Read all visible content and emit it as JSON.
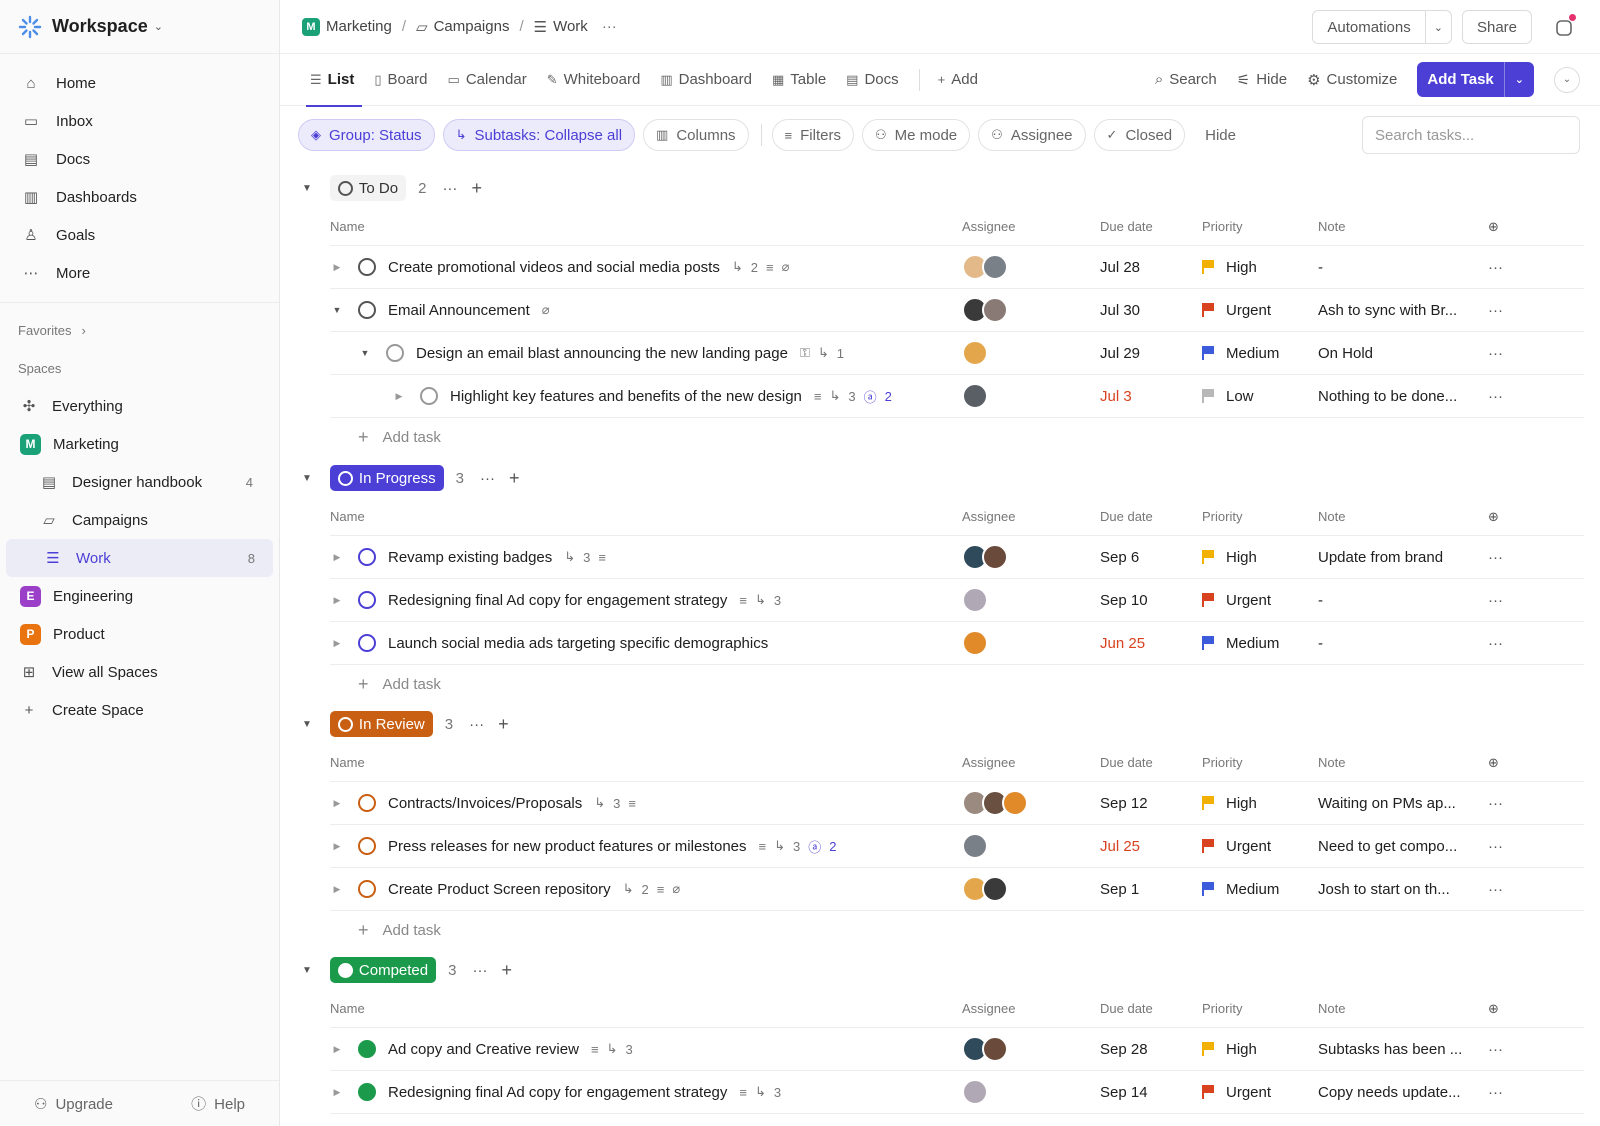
{
  "workspace": {
    "title": "Workspace"
  },
  "nav": {
    "home": "Home",
    "inbox": "Inbox",
    "docs": "Docs",
    "dashboards": "Dashboards",
    "goals": "Goals",
    "more": "More"
  },
  "favorites": {
    "label": "Favorites"
  },
  "spaces": {
    "label": "Spaces",
    "everything": "Everything",
    "marketing": {
      "letter": "M",
      "label": "Marketing",
      "color": "#1aa177"
    },
    "designer_handbook": {
      "label": "Designer handbook",
      "count": "4"
    },
    "campaigns": "Campaigns",
    "work": {
      "label": "Work",
      "count": "8"
    },
    "engineering": {
      "letter": "E",
      "label": "Engineering",
      "color": "#9b3fc9"
    },
    "product": {
      "letter": "P",
      "label": "Product",
      "color": "#e8730f"
    },
    "view_all": "View all Spaces",
    "create": "Create Space"
  },
  "footer": {
    "upgrade": "Upgrade",
    "help": "Help"
  },
  "breadcrumb": {
    "space_letter": "M",
    "space": "Marketing",
    "folder": "Campaigns",
    "list": "Work"
  },
  "top_actions": {
    "automations": "Automations",
    "share": "Share"
  },
  "tabs": {
    "list": "List",
    "board": "Board",
    "calendar": "Calendar",
    "whiteboard": "Whiteboard",
    "dashboard": "Dashboard",
    "table": "Table",
    "docs": "Docs",
    "add": "Add"
  },
  "tab_actions": {
    "search": "Search",
    "hide": "Hide",
    "customize": "Customize",
    "add_task": "Add Task"
  },
  "filters": {
    "group": "Group: Status",
    "subtasks": "Subtasks: Collapse all",
    "columns": "Columns",
    "filters": "Filters",
    "me_mode": "Me mode",
    "assignee": "Assignee",
    "closed": "Closed",
    "hide": "Hide",
    "search_placeholder": "Search tasks..."
  },
  "columns": {
    "name": "Name",
    "assignee": "Assignee",
    "due": "Due date",
    "priority": "Priority",
    "note": "Note"
  },
  "add_task": "Add task",
  "colors": {
    "accent": "#4b3fd6",
    "urgent": "#d8421f",
    "high": "#f2b000",
    "medium": "#3b5bdb",
    "low": "#b8b8b8"
  },
  "groups": [
    {
      "label": "To Do",
      "count": "2",
      "color": "#555555",
      "tasks": [
        {
          "name": "Create promotional videos and social media posts",
          "meta": "2",
          "due": "Jul 28",
          "priority": "High",
          "note": "-"
        },
        {
          "name": "Email Announcement",
          "meta": "",
          "due": "Jul 30",
          "priority": "Urgent",
          "note": "Ash to sync with Br..."
        },
        {
          "name": "Design an email blast announcing the new landing page",
          "meta": "1",
          "due": "Jul 29",
          "priority": "Medium",
          "note": "On Hold"
        },
        {
          "name": "Highlight key features and benefits of the new design",
          "meta": "3",
          "meta2": "2",
          "due": "Jul 3",
          "priority": "Low",
          "note": "Nothing to be done..."
        }
      ]
    },
    {
      "label": "In Progress",
      "count": "3",
      "color": "#4b3fd6",
      "tasks": [
        {
          "name": "Revamp existing badges",
          "meta": "3",
          "due": "Sep 6",
          "priority": "High",
          "note": "Update from brand"
        },
        {
          "name": "Redesigning final Ad copy for engagement strategy",
          "meta": "3",
          "due": "Sep 10",
          "priority": "Urgent",
          "note": "-"
        },
        {
          "name": "Launch social media ads targeting specific demographics",
          "meta": "",
          "due": "Jun 25",
          "priority": "Medium",
          "note": "-"
        }
      ]
    },
    {
      "label": "In Review",
      "count": "3",
      "color": "#c95f12",
      "tasks": [
        {
          "name": "Contracts/Invoices/Proposals",
          "meta": "3",
          "due": "Sep 12",
          "priority": "High",
          "note": "Waiting on PMs ap..."
        },
        {
          "name": "Press releases for new product features or milestones",
          "meta": "3",
          "meta2": "2",
          "due": "Jul 25",
          "priority": "Urgent",
          "note": "Need to get compo..."
        },
        {
          "name": "Create Product Screen repository",
          "meta": "2",
          "due": "Sep 1",
          "priority": "Medium",
          "note": "Josh to start on th..."
        }
      ]
    },
    {
      "label": "Competed",
      "count": "3",
      "color": "#1a9a4a",
      "tasks": [
        {
          "name": "Ad copy and Creative review",
          "meta": "3",
          "due": "Sep 28",
          "priority": "High",
          "note": "Subtasks has been ..."
        },
        {
          "name": "Redesigning final Ad copy for engagement strategy",
          "meta": "3",
          "due": "Sep 14",
          "priority": "Urgent",
          "note": "Copy needs update..."
        }
      ]
    }
  ]
}
